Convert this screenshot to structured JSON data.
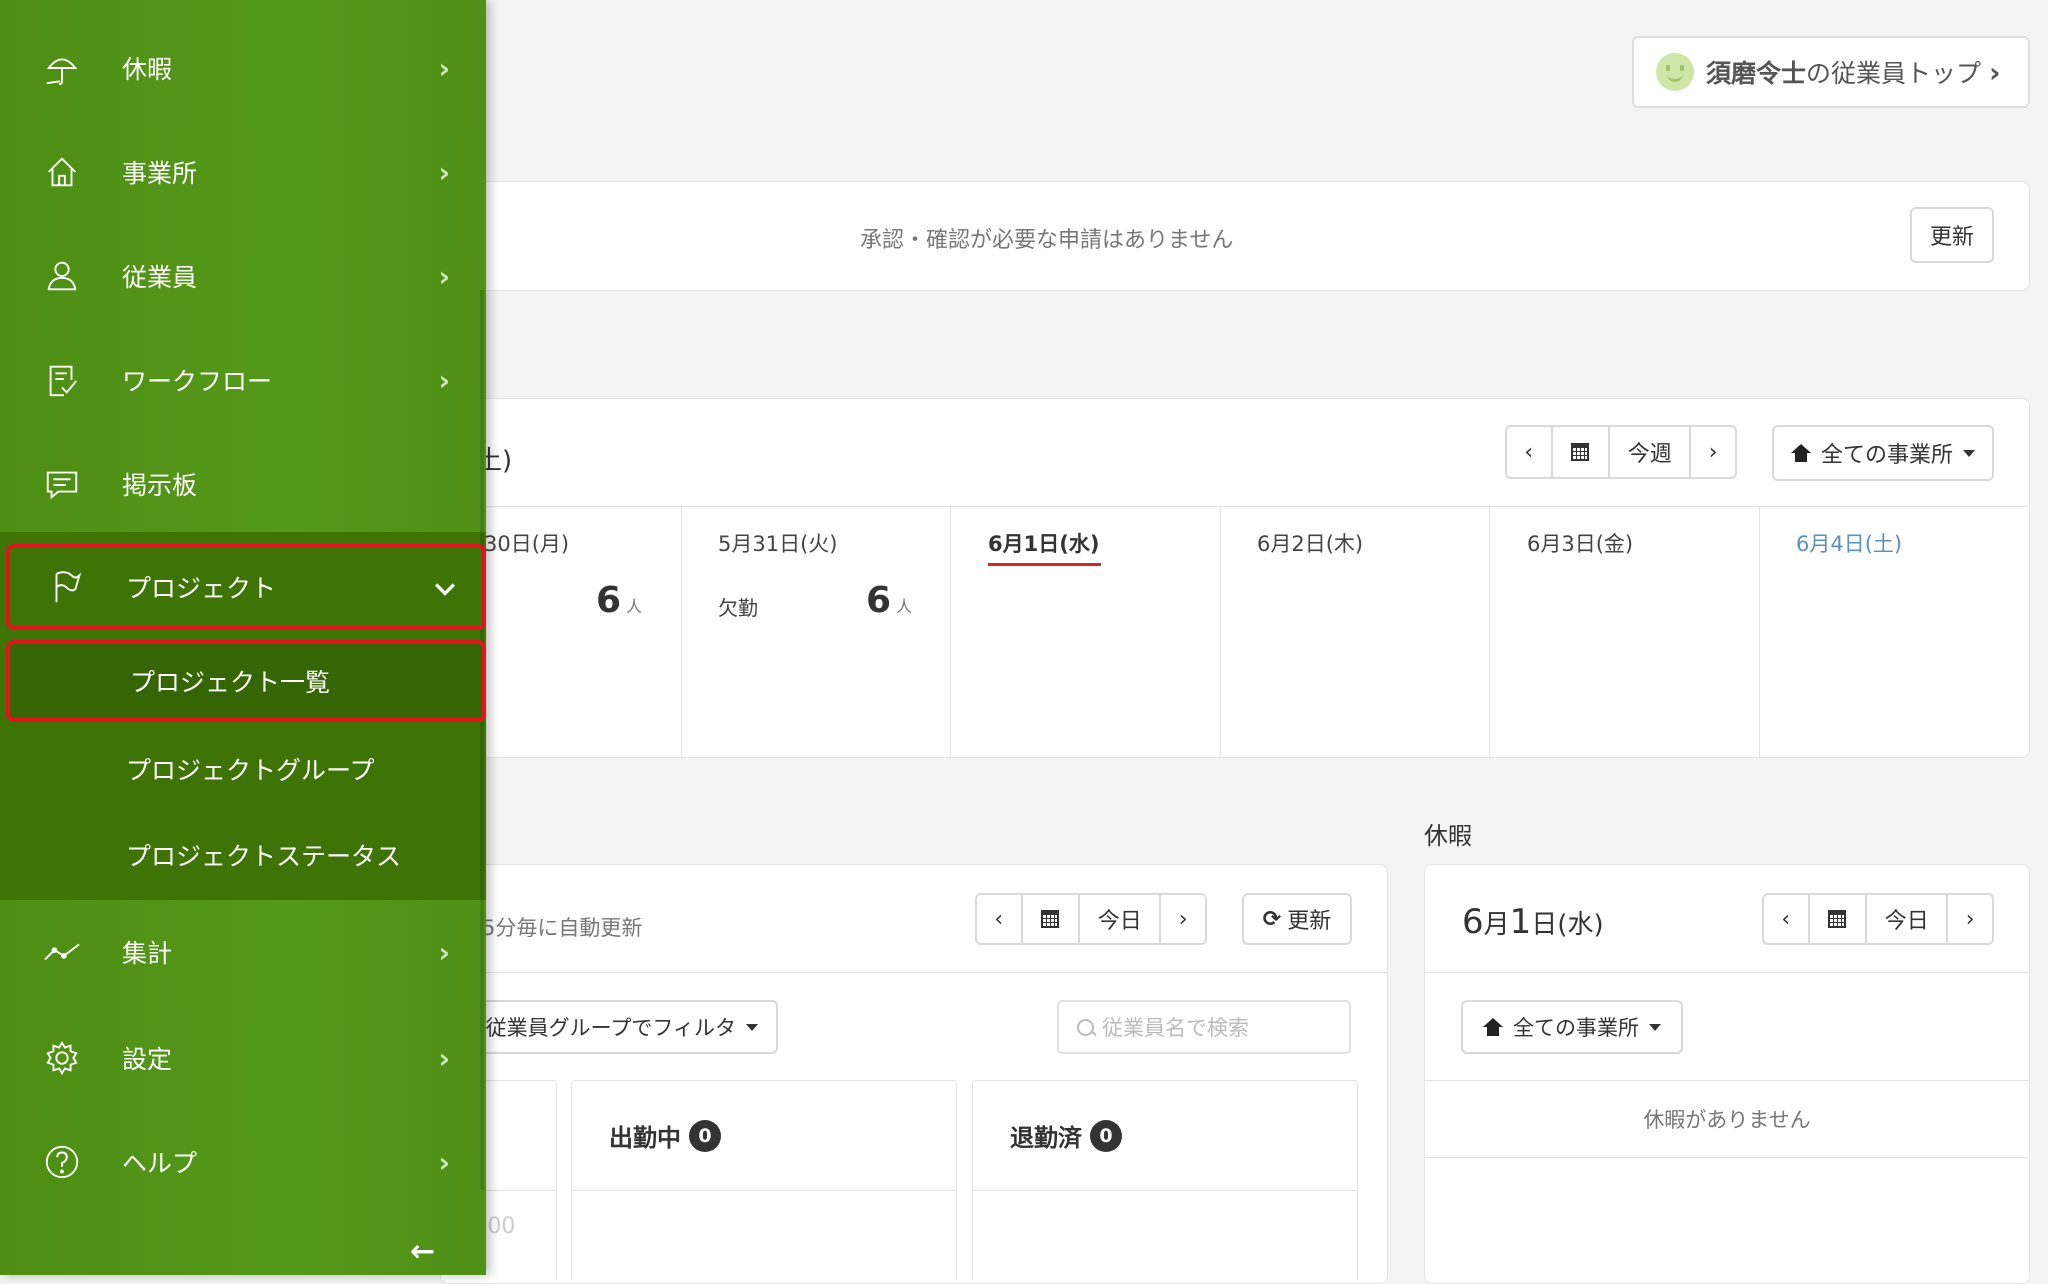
{
  "header": {
    "employee_top_name": "須磨令士",
    "employee_top_suffix": "の従業員トップ",
    "chevron": "›"
  },
  "approval": {
    "message": "承認・確認が必要な申請はありません",
    "refresh_label": "更新"
  },
  "schedule": {
    "title_fragment": "土)",
    "nav": {
      "prev": "‹",
      "today_label": "今週",
      "next": "›"
    },
    "office_filter": "全ての事業所",
    "days": [
      {
        "label": "30日(月)",
        "count": "6",
        "unit": "人"
      },
      {
        "label": "5月31日(火)",
        "absence_label": "欠勤",
        "count": "6",
        "unit": "人"
      },
      {
        "label": "6月1日(水)"
      },
      {
        "label": "6月2日(木)"
      },
      {
        "label": "6月3日(金)"
      },
      {
        "label": "6月4日(土)"
      }
    ]
  },
  "attendance": {
    "auto_refresh_text": "5分毎に自動更新",
    "nav": {
      "prev": "‹",
      "today_label": "今日",
      "next": "›"
    },
    "refresh_label": "更新",
    "group_filter": "従業員グループでフィルタ",
    "search_placeholder": "従業員名で検索",
    "columns": [
      {
        "title": "出勤中",
        "count": "0"
      },
      {
        "title": "退勤済",
        "count": "0"
      }
    ],
    "faded_time": ":00"
  },
  "leave": {
    "section_title": "休暇",
    "date_month": "6",
    "date_month_suffix": "月",
    "date_day": "1",
    "date_day_suffix": "日(水)",
    "nav": {
      "prev": "‹",
      "today_label": "今日",
      "next": "›"
    },
    "office_filter": "全ての事業所",
    "empty_message": "休暇がありません"
  },
  "sidebar": {
    "items": [
      {
        "label": "休暇",
        "icon": "umbrella-icon"
      },
      {
        "label": "事業所",
        "icon": "home-icon"
      },
      {
        "label": "従業員",
        "icon": "person-icon"
      },
      {
        "label": "ワークフロー",
        "icon": "checklist-icon"
      },
      {
        "label": "掲示板",
        "icon": "chat-icon"
      },
      {
        "label": "プロジェクト",
        "icon": "flag-icon"
      },
      {
        "label": "集計",
        "icon": "chart-line-icon"
      },
      {
        "label": "設定",
        "icon": "gear-icon"
      },
      {
        "label": "ヘルプ",
        "icon": "help-icon"
      }
    ],
    "project_submenu": [
      "プロジェクト一覧",
      "プロジェクトグループ",
      "プロジェクトステータス"
    ],
    "chevron_right": "›",
    "chevron_down": "⌄",
    "collapse_arrow": "←"
  },
  "colors": {
    "sidebar_green": "#55991a",
    "submenu_green": "#3e7406",
    "highlight_red": "#e3141d",
    "today_underline": "#d9232a",
    "saturday_blue": "#5b8fbf"
  }
}
